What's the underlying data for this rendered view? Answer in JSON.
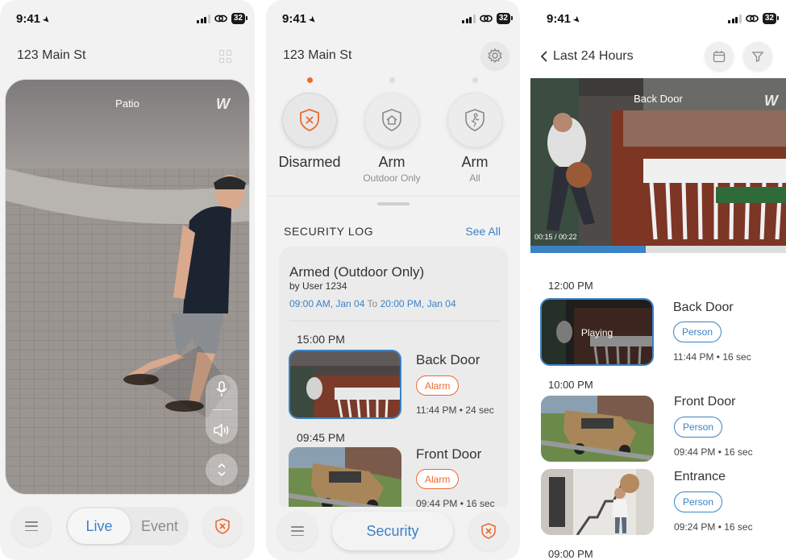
{
  "statusbar": {
    "time": "9:41",
    "battery": "32"
  },
  "screen1": {
    "address": "123 Main St",
    "camera_label": "Patio",
    "logo": "W",
    "tabs": {
      "live": "Live",
      "event": "Event"
    }
  },
  "screen2": {
    "address": "123 Main St",
    "modes": [
      {
        "name": "Disarmed",
        "sub": "",
        "active": true
      },
      {
        "name": "Arm",
        "sub": "Outdoor Only",
        "active": false
      },
      {
        "name": "Arm",
        "sub": "All",
        "active": false
      }
    ],
    "log_title": "SECURITY LOG",
    "see_all": "See All",
    "armed": {
      "title": "Armed (Outdoor Only)",
      "by": "by User 1234",
      "from": "09:00 AM, Jan 04",
      "to_word": "To",
      "to": "20:00 PM, Jan 04"
    },
    "events": [
      {
        "time": "15:00 PM",
        "name": "Back Door",
        "tag": "Alarm",
        "meta": "11:44 PM • 24 sec"
      },
      {
        "time": "09:45 PM",
        "name": "Front Door",
        "tag": "Alarm",
        "meta": "09:44 PM • 16 sec"
      }
    ],
    "security_button": "Security"
  },
  "screen3": {
    "title": "Last 24 Hours",
    "camera_label": "Back Door",
    "timecode": "00:15 / 00:22",
    "progress": 0.45,
    "hours": [
      "12:00 PM",
      "10:00 PM",
      "09:00 PM"
    ],
    "playing_label": "Playing",
    "events": [
      {
        "name": "Back Door",
        "tag": "Person",
        "meta": "11:44 PM • 16 sec"
      },
      {
        "name": "Front Door",
        "tag": "Person",
        "meta": "09:44 PM • 16 sec"
      },
      {
        "name": "Entrance",
        "tag": "Person",
        "meta": "09:24 PM • 16 sec"
      }
    ]
  },
  "colors": {
    "accent_blue": "#3b82c4",
    "alarm_orange": "#ec6a2f",
    "background": "#f2f2f3"
  },
  "icons": [
    "location-arrow-icon",
    "signal-icon",
    "link-icon",
    "battery-icon",
    "grid-icon",
    "mic-icon",
    "speaker-icon",
    "expand-icon",
    "menu-icon",
    "shield-x-icon",
    "gear-icon",
    "shield-home-icon",
    "shield-person-icon",
    "chevron-left-icon",
    "calendar-icon",
    "filter-icon"
  ]
}
